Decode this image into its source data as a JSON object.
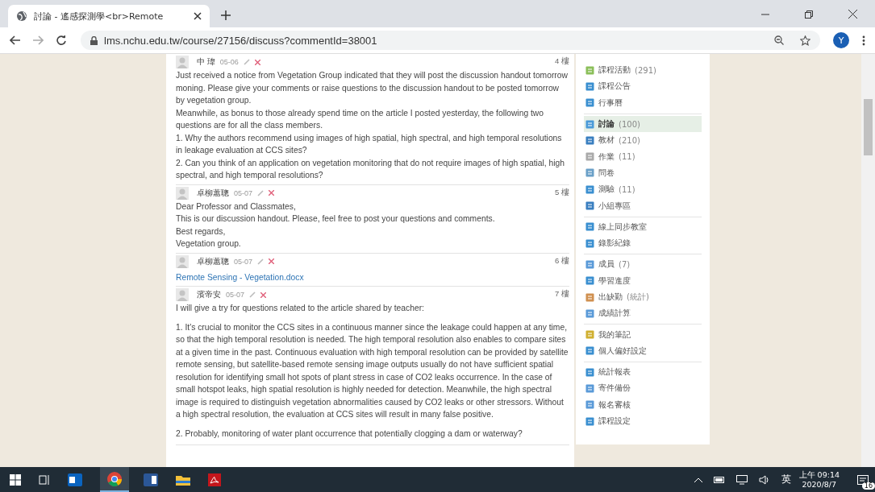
{
  "browser": {
    "tab_title": "討論 - 遙感探測學<br>Remote",
    "url": "lms.nchu.edu.tw/course/27156/discuss?commentId=38001",
    "profile_initial": "Y"
  },
  "posts": [
    {
      "author": "中 瑋",
      "date": "05-06",
      "floor": "4 樓",
      "spaced": false,
      "paragraphs": [
        "Just received a notice from Vegetation Group indicated that they will post the discussion handout tomorrow moning. Please give your comments or raise questions to the discussion handout to be posted tomorrow by vegetation group.",
        "Meanwhile, as bonus to those already spend time on the article I posted yesterday, the following two questions are for all the class members.",
        "1. Why the authors recommend using images of high spatial, high spectral, and high temporal resolutions in leakage evaluation at CCS sites?",
        "2.  Can you think of an application on vegetation monitoring that do not require images of high spatial, high spectral, and high temporal resolutions?"
      ]
    },
    {
      "author": "卓柳蕙聰",
      "date": "05-07",
      "floor": "5 樓",
      "spaced": false,
      "paragraphs": [
        "Dear Professor and Classmates,",
        "This is our discussion handout. Please, feel free to post your questions and comments.",
        "Best regards,",
        "Vegetation group."
      ]
    },
    {
      "author": "卓柳蕙聰",
      "date": "05-07",
      "floor": "6 樓",
      "spaced": false,
      "attachment": "Remote Sensing - Vegetation.docx"
    },
    {
      "author": "濱帝安",
      "date": "05-07",
      "floor": "7 樓",
      "spaced": true,
      "paragraphs": [
        "I will give a try for questions related to the article shared by teacher:",
        "1. It's crucial to monitor the CCS sites in a continuous manner since the leakage could happen at any time, so that the high temporal resolution is needed. The high temporal resolution also enables to compare sites at a given time in the past. Continuous evaluation with high temporal resolution can be provided by satellite remote sensing, but satellite-based remote sensing image outputs usually do not have sufficient spatial resolution for identifying small hot spots of plant stress in case of CO2 leaks occurrence. In the case of small hotspot leaks, high spatial resolution is highly needed for detection. Meanwhile, the high spectral image is required to distinguish vegetation abnormalities caused by CO2 leaks or other stressors. Without a high spectral resolution, the evaluation at CCS sites will result in many false positive.",
        "2. Probably, monitoring of water plant occurrence that potentially clogging a dam or waterway?"
      ]
    }
  ],
  "sidebar": {
    "groups": [
      [
        {
          "label": "課程活動",
          "count": "(291)",
          "selected": false
        },
        {
          "label": "課程公告",
          "selected": false
        },
        {
          "label": "行事曆",
          "selected": false
        }
      ],
      [
        {
          "label": "討論",
          "count": "(100)",
          "selected": true
        },
        {
          "label": "教材",
          "count": "(210)",
          "selected": false
        },
        {
          "label": "作業",
          "count": "(11)",
          "selected": false
        },
        {
          "label": "問卷",
          "selected": false
        },
        {
          "label": "測驗",
          "count": "(11)",
          "selected": false
        },
        {
          "label": "小組專區",
          "selected": false
        }
      ],
      [
        {
          "label": "線上同步教室",
          "selected": false
        },
        {
          "label": "錄影紀錄",
          "selected": false
        }
      ],
      [
        {
          "label": "成員",
          "count": "(7)",
          "selected": false
        },
        {
          "label": "學習進度",
          "selected": false
        },
        {
          "label": "出缺勤",
          "count": "(統計)",
          "selected": false
        },
        {
          "label": "成績計算",
          "selected": false
        }
      ],
      [
        {
          "label": "我的筆記",
          "selected": false
        },
        {
          "label": "個人偏好設定",
          "selected": false
        }
      ],
      [
        {
          "label": "統計報表",
          "selected": false
        },
        {
          "label": "寄件備份",
          "selected": false
        },
        {
          "label": "報名審核",
          "selected": false
        },
        {
          "label": "課程設定",
          "selected": false
        }
      ]
    ]
  },
  "taskbar": {
    "ime": "英",
    "time": "上午 09:14",
    "date": "2020/8/7",
    "notifications": "16"
  }
}
